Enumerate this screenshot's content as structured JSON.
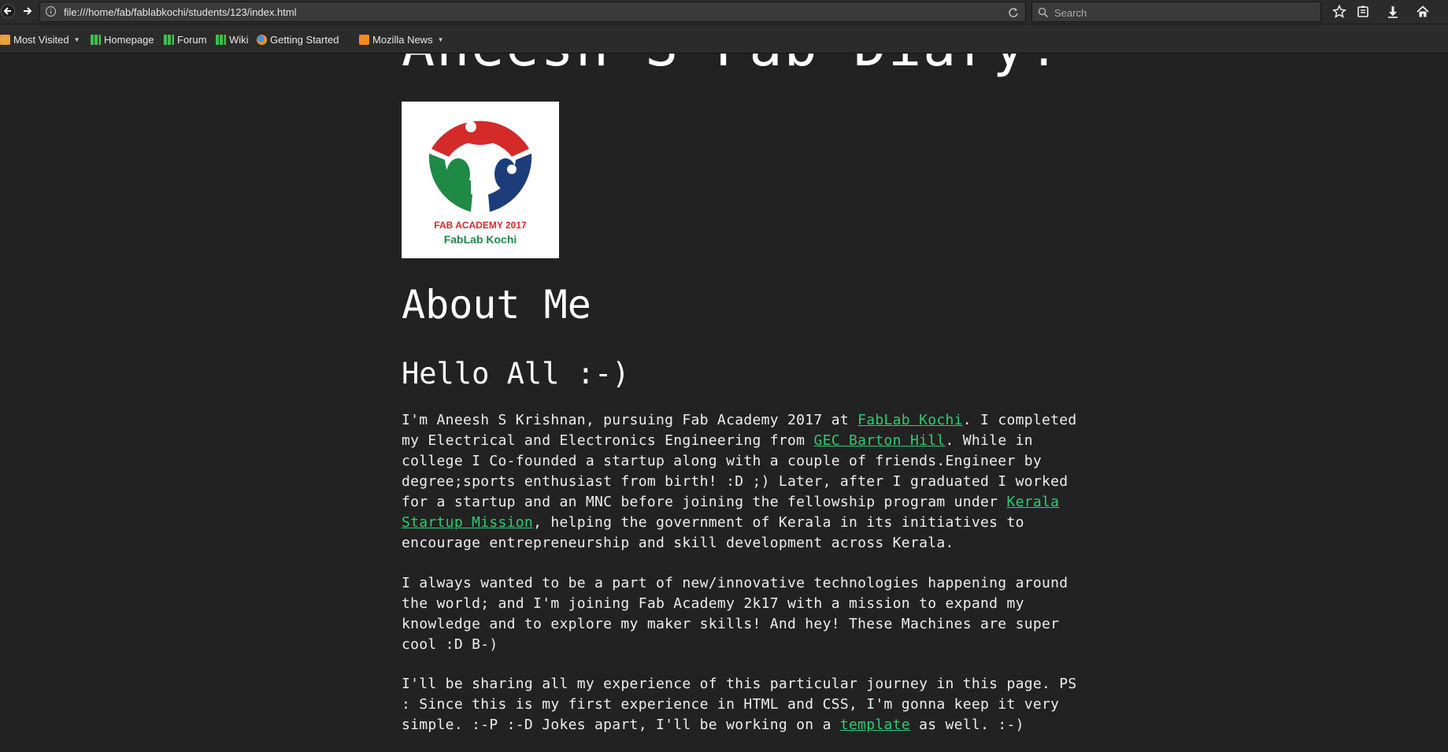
{
  "browser": {
    "url": "file:///home/fab/fablabkochi/students/123/index.html",
    "search_placeholder": "Search",
    "bookmarks": [
      {
        "label": "Most Visited",
        "icon": "most-visited-icon",
        "dropdown": true
      },
      {
        "label": "Homepage",
        "icon": "fablab-icon"
      },
      {
        "label": "Forum",
        "icon": "fablab-icon"
      },
      {
        "label": "Wiki",
        "icon": "fablab-icon"
      },
      {
        "label": "Getting Started",
        "icon": "firefox-icon"
      },
      {
        "label": "Mozilla News",
        "icon": "rss-icon",
        "dropdown": true
      }
    ]
  },
  "page": {
    "title": "Aneesh S Fab Diary!",
    "logo": {
      "line1": "FAB ACADEMY 2017",
      "line2": "FabLab Kochi"
    },
    "about_heading": "About Me",
    "hello_heading": "Hello All :-)",
    "p1": {
      "t1": "I'm Aneesh S Krishnan, pursuing Fab Academy 2017 at ",
      "l1": "FabLab Kochi",
      "t2": ". I completed my Electrical and Electronics Engineering from ",
      "l2": "GEC Barton Hill",
      "t3": ". While in college I Co-founded a startup along with a couple of friends.Engineer by degree;sports enthusiast from birth! :D ;) Later, after I graduated I worked for a startup and an MNC before joining the fellowship program under ",
      "l3": "Kerala Startup Mission",
      "t4": ", helping the government of Kerala in its initiatives to encourage entrepreneurship and skill development across Kerala."
    },
    "p2": "I always wanted to be a part of new/innovative technologies happening around the world; and I'm joining Fab Academy 2k17 with a mission to expand my knowledge and to explore my maker skills! And hey! These Machines are super cool :D B-)",
    "p3": {
      "t1": "I'll be sharing all my experience of this particular journey in this page. PS : Since this is my first experience in HTML and CSS, I'm gonna keep it very simple. :-P :-D Jokes apart, I'll be working on a ",
      "l1": "template",
      "t2": " as well. :-)"
    }
  },
  "colors": {
    "background": "#222222",
    "link": "#2ecc71",
    "text": "#eeeeee"
  }
}
